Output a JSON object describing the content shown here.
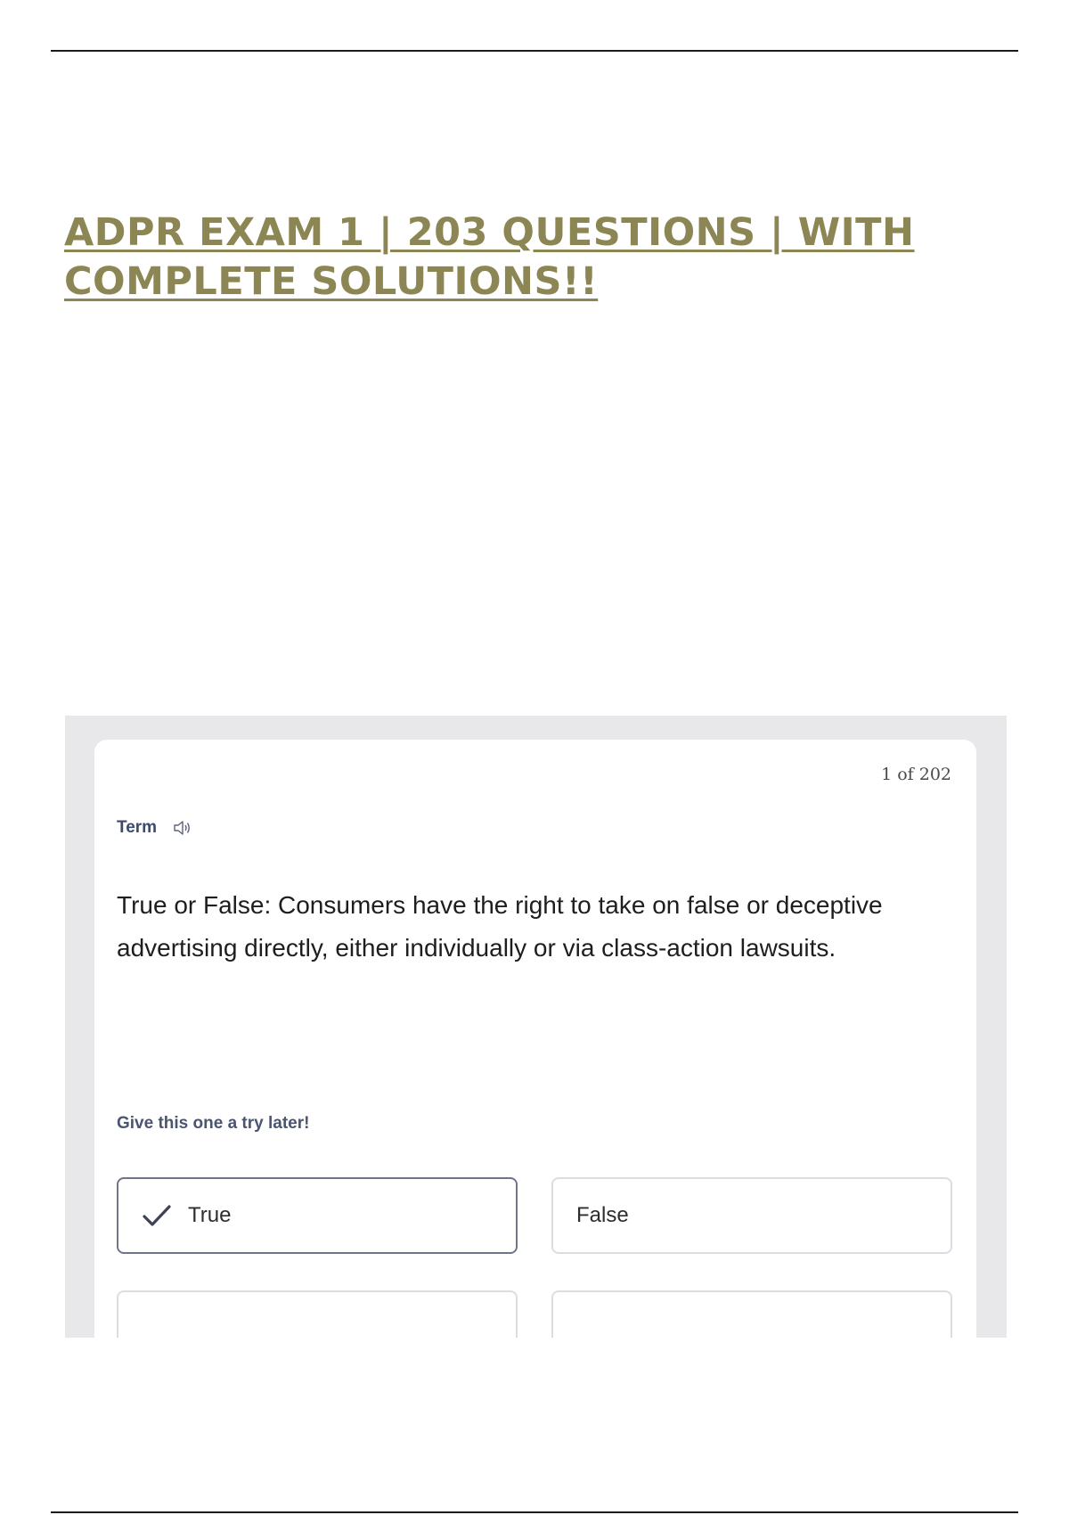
{
  "document": {
    "title": "ADPR EXAM 1 | 203 QUESTIONS | WITH COMPLETE SOLUTIONS!!"
  },
  "flashcard": {
    "counter": "1 of 202",
    "term_label": "Term",
    "icon": "speaker-icon",
    "question": "True or False: Consumers have the right to take on false or deceptive advertising directly, either individually or via class-action lawsuits.",
    "hint": "Give this one a try later!",
    "options": [
      {
        "label": "True",
        "selected": true,
        "icon": "check-icon"
      },
      {
        "label": "False",
        "selected": false
      }
    ]
  },
  "colors": {
    "title": "#8c8654",
    "selected_border": "#6f7488",
    "label_text": "#3d4a6b"
  }
}
